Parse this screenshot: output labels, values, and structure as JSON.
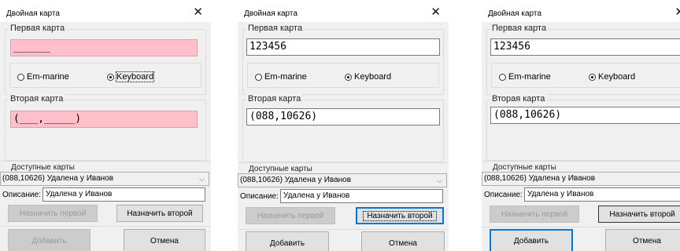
{
  "dialog_title": "Двойная карта",
  "close_glyph": "✕",
  "first_card_label": "Первая карта",
  "second_card_label": "Вторая карта",
  "radio_em_marine": "Em-marine",
  "radio_keyboard": "Keyboard",
  "available_cards_label": "Доступные карты",
  "combo_arrow": "⌵",
  "description_label": "Описание:",
  "assign_first": "Назначить первой",
  "assign_second": "Назначить второй",
  "add_button": "Добавить",
  "cancel_button": "Отмена",
  "colors": {
    "error_fill": "#ffc0cb",
    "focus_blue": "#0078d7"
  },
  "dialogs": [
    {
      "first_value": "______",
      "second_value": "(___,_____)",
      "selected_card": "(088,10626) Удалена у Иванов",
      "description": "Удалена у Иванов",
      "radio_selected": "keyboard",
      "focused": "keyboard-radio"
    },
    {
      "first_value": "123456",
      "second_value": "(088,10626)",
      "selected_card": "(088,10626) Удалена у Иванов",
      "description": "Удалена у Иванов",
      "radio_selected": "keyboard",
      "focused": "assign-second-button"
    },
    {
      "first_value": "123456",
      "second_value": "(088,10626)",
      "selected_card": "(088,10626) Удалена у Иванов",
      "description": "Удалена у Иванов",
      "radio_selected": "keyboard",
      "focused": "add-button"
    }
  ]
}
